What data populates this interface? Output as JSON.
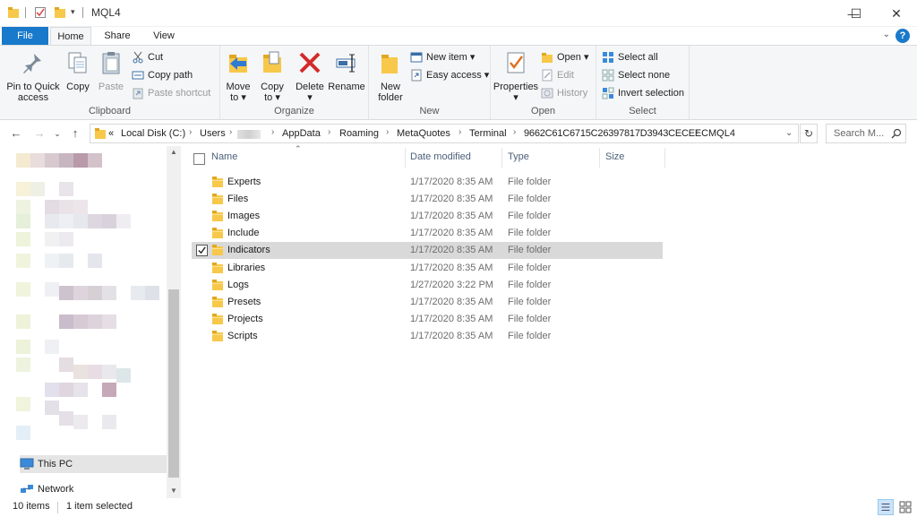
{
  "window": {
    "title": "MQL4",
    "controls": {
      "minimize": "—",
      "maximize": "☐",
      "close": "✕"
    }
  },
  "ribbon": {
    "tabs": {
      "file": "File",
      "home": "Home",
      "share": "Share",
      "view": "View"
    },
    "help": "?",
    "clipboard": {
      "label": "Clipboard",
      "pin_line1": "Pin to Quick",
      "pin_line2": "access",
      "copy": "Copy",
      "paste": "Paste",
      "cut": "Cut",
      "copy_path": "Copy path",
      "paste_shortcut": "Paste shortcut"
    },
    "organize": {
      "label": "Organize",
      "move_to_line1": "Move",
      "move_to_line2": "to ▾",
      "copy_to_line1": "Copy",
      "copy_to_line2": "to ▾",
      "delete_line1": "Delete",
      "delete_line2": "▾",
      "rename": "Rename"
    },
    "new": {
      "label": "New",
      "new_folder_line1": "New",
      "new_folder_line2": "folder",
      "new_item": "New item ▾",
      "easy_access": "Easy access ▾"
    },
    "open": {
      "label": "Open",
      "properties_line1": "Properties",
      "properties_line2": "▾",
      "open": "Open ▾",
      "edit": "Edit",
      "history": "History"
    },
    "select": {
      "label": "Select",
      "select_all": "Select all",
      "select_none": "Select none",
      "invert_selection": "Invert selection"
    }
  },
  "address": {
    "prefix": "«",
    "crumbs": [
      "Local Disk (C:)",
      "Users",
      "AppData",
      "Roaming",
      "MetaQuotes",
      "Terminal",
      "9662C61C6715C26397817D3943CECEEC",
      "MQL4"
    ],
    "search_placeholder": "Search M..."
  },
  "nav_pane": {
    "this_pc": "This PC",
    "network": "Network"
  },
  "file_list": {
    "columns": {
      "name": "Name",
      "date": "Date modified",
      "type": "Type",
      "size": "Size"
    },
    "rows": [
      {
        "name": "Experts",
        "date": "1/17/2020 8:35 AM",
        "type": "File folder"
      },
      {
        "name": "Files",
        "date": "1/17/2020 8:35 AM",
        "type": "File folder"
      },
      {
        "name": "Images",
        "date": "1/17/2020 8:35 AM",
        "type": "File folder"
      },
      {
        "name": "Include",
        "date": "1/17/2020 8:35 AM",
        "type": "File folder"
      },
      {
        "name": "Indicators",
        "date": "1/17/2020 8:35 AM",
        "type": "File folder",
        "selected": true
      },
      {
        "name": "Libraries",
        "date": "1/17/2020 8:35 AM",
        "type": "File folder"
      },
      {
        "name": "Logs",
        "date": "1/27/2020 3:22 PM",
        "type": "File folder"
      },
      {
        "name": "Presets",
        "date": "1/17/2020 8:35 AM",
        "type": "File folder"
      },
      {
        "name": "Projects",
        "date": "1/17/2020 8:35 AM",
        "type": "File folder"
      },
      {
        "name": "Scripts",
        "date": "1/17/2020 8:35 AM",
        "type": "File folder"
      }
    ]
  },
  "status": {
    "item_count": "10 items",
    "selected": "1 item selected"
  },
  "colors": {
    "accent": "#1979ca",
    "folder_yellow": "#f7c84a",
    "selected_row": "#d9d9d9",
    "header_text": "#4c607a"
  }
}
